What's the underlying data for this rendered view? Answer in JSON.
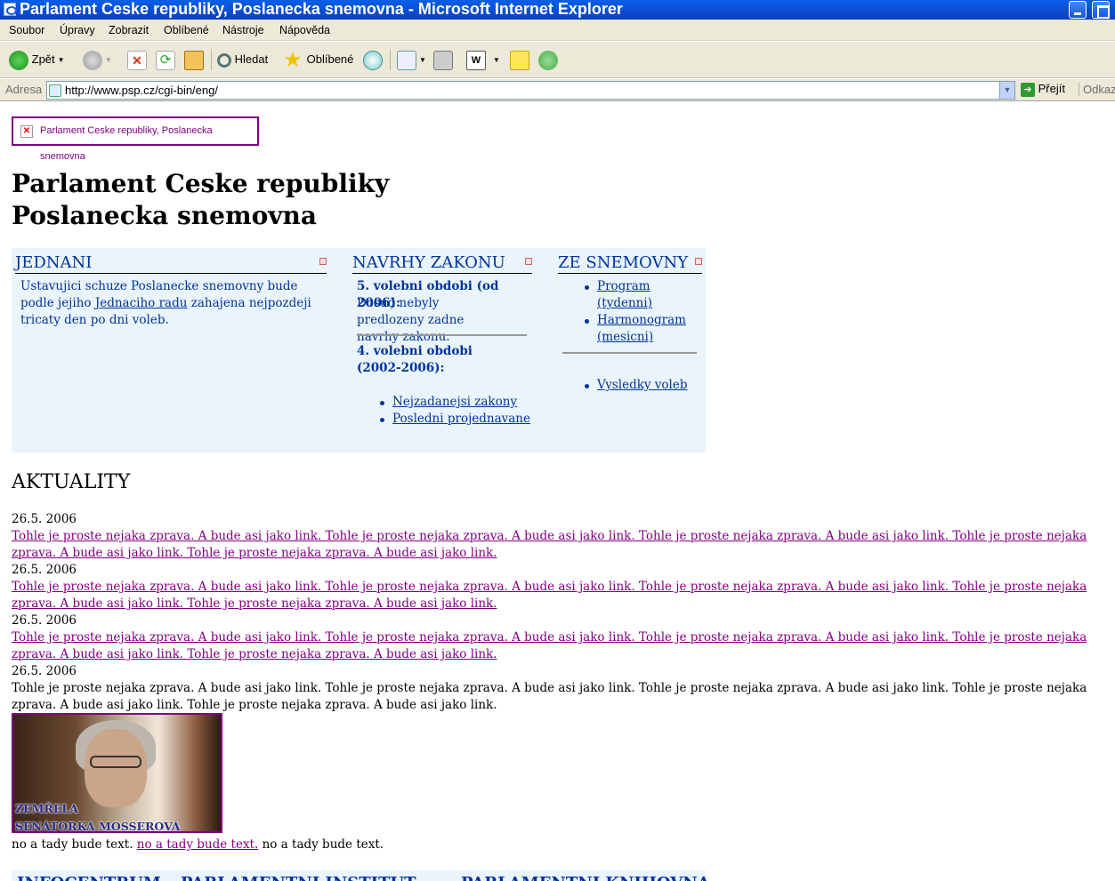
{
  "window": {
    "title": "Parlament Ceske republiky, Poslanecka snemovna - Microsoft Internet Explorer"
  },
  "menu": [
    "Soubor",
    "Úpravy",
    "Zobrazit",
    "Oblíbené",
    "Nástroje",
    "Nápověda"
  ],
  "toolbar": {
    "back_label": "Zpět",
    "search_label": "Hledat",
    "favorites_label": "Oblíbené",
    "word_label": "W"
  },
  "address": {
    "label": "Adresa",
    "url": "http://www.psp.cz/cgi-bin/eng/",
    "go_label": "Přejít",
    "links_label": "Odkazy"
  },
  "page": {
    "logo_alt": "Parlament Ceske republiky, Poslanecka snemovna",
    "title_line1": "Parlament Ceske republiky",
    "title_line2": "Poslanecka snemovna",
    "jednani": {
      "heading": "JEDNANI",
      "text_before": "Ustavujici schuze Poslanecke snemovny bude podle jejiho ",
      "link": "Jednaciho radu",
      "text_after": " zahajena nejpozdeji tricaty den po dni voleb."
    },
    "navrhy": {
      "heading": "NAVRHY ZAKONU",
      "period1": "5. volebni obdobi (od 2006):",
      "period1_text": "Dosud nebyly predlozeny zadne navrhy zakonu.",
      "period2": "4. volebni obdobi (2002-2006):",
      "links": [
        "Nejzadanejsi zakony",
        "Posledni projednavane"
      ]
    },
    "snemovna": {
      "heading": "ZE SNEMOVNY",
      "links": [
        "Program (tydenni)",
        "Harmonogram (mesicni)"
      ],
      "links2": [
        "Vysledky voleb"
      ]
    },
    "aktuality_heading": "AKTUALITY",
    "news": [
      {
        "date": "26.5. 2006",
        "text": "Tohle je proste nejaka zprava. A bude asi jako link. Tohle je proste nejaka zprava. A bude asi jako link. Tohle je proste nejaka zprava. A bude asi jako link. Tohle je proste nejaka zprava. A bude asi jako link. Tohle je proste nejaka zprava. A bude asi jako link."
      },
      {
        "date": "26.5. 2006",
        "text": "Tohle je proste nejaka zprava. A bude asi jako link. Tohle je proste nejaka zprava. A bude asi jako link. Tohle je proste nejaka zprava. A bude asi jako link. Tohle je proste nejaka zprava. A bude asi jako link. Tohle je proste nejaka zprava. A bude asi jako link."
      },
      {
        "date": "26.5. 2006",
        "text": "Tohle je proste nejaka zprava. A bude asi jako link. Tohle je proste nejaka zprava. A bude asi jako link. Tohle je proste nejaka zprava. A bude asi jako link. Tohle je proste nejaka zprava. A bude asi jako link. Tohle je proste nejaka zprava. A bude asi jako link."
      },
      {
        "date": "26.5. 2006",
        "text": "Tohle je proste nejaka zprava. A bude asi jako link. Tohle je proste nejaka zprava. A bude asi jako link. Tohle je proste nejaka zprava. A bude asi jako link. Tohle je proste nejaka zprava. A bude asi jako link. Tohle je proste nejaka zprava. A bude asi jako link."
      }
    ],
    "photo_caption_line1": "ZEMŘELA",
    "photo_caption_line2": "SENÁTORKA MOSSEROVÁ",
    "after_text1": "no a tady bude text. ",
    "after_link": "no a tady bude text.",
    "after_text2": " no a tady bude text.",
    "bottom_headings": [
      "INFOCENTRUM",
      "PARLAMENTNI INSTITUT",
      "PARLAMENTNI KNIHOVNA"
    ]
  }
}
